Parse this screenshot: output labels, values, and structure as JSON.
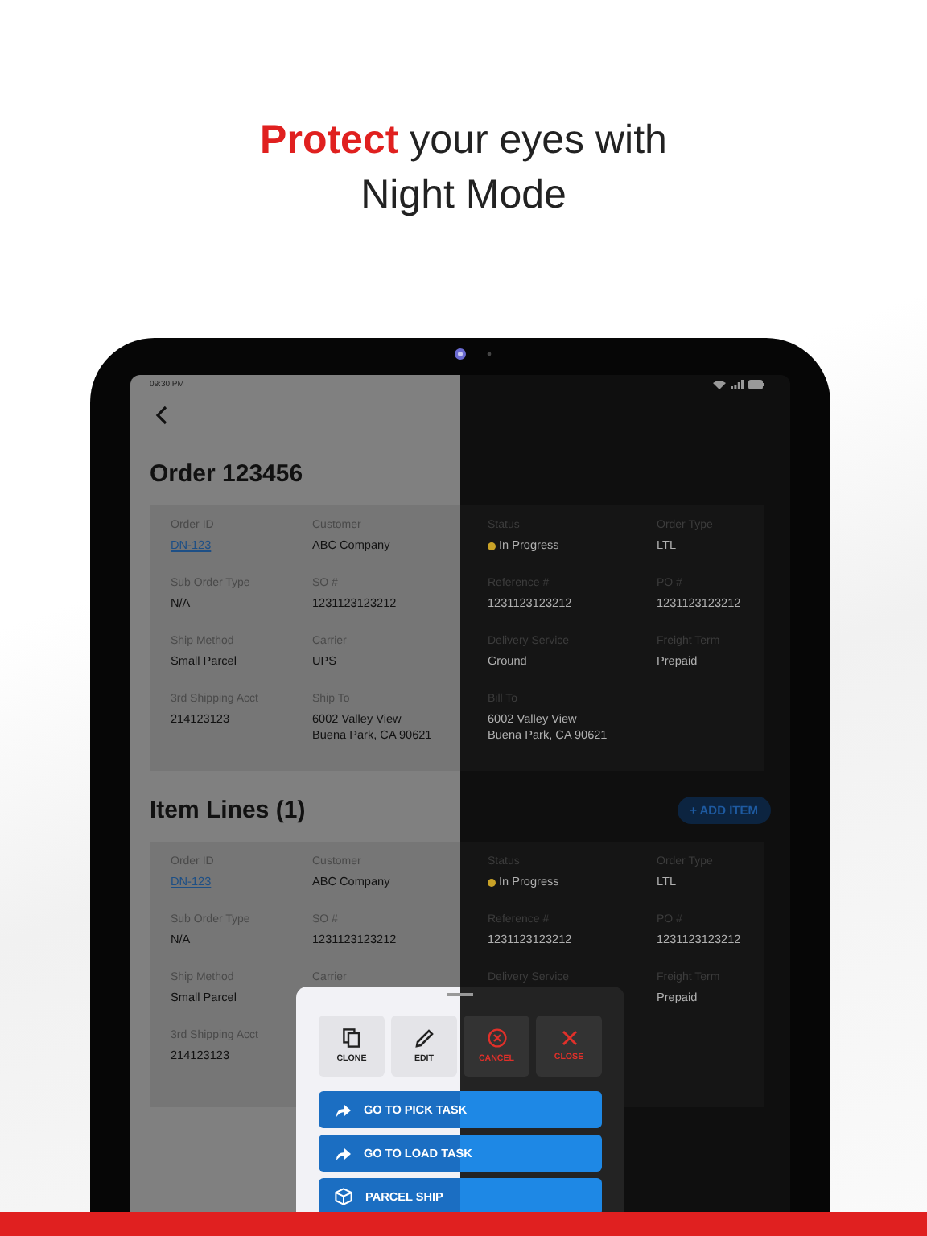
{
  "headline": {
    "line1": "**Protect** your eyes with",
    "line2": "Night Mode"
  },
  "status_bar": {
    "time": "09:30 PM"
  },
  "order": {
    "title": "Order 123456",
    "columns": [
      [
        {
          "label": "Order ID",
          "value": "DN-123",
          "kind": "link"
        },
        {
          "label": "Sub Order Type",
          "value": "N/A",
          "kind": "text"
        },
        {
          "label": "Ship Method",
          "value": "Small Parcel",
          "kind": "text"
        },
        {
          "label": "3rd Shipping Acct",
          "value": "214123123",
          "kind": "text"
        }
      ],
      [
        {
          "label": "Customer",
          "value": "ABC Company",
          "kind": "text"
        },
        {
          "label": "SO #",
          "value": "1231123123212",
          "kind": "text"
        },
        {
          "label": "Carrier",
          "value": "UPS",
          "kind": "text"
        },
        {
          "label": "Ship To",
          "value": "6002 Valley View\nBuena Park, CA 90621",
          "kind": "text"
        }
      ],
      [
        {
          "label": "Status",
          "value": "In Progress",
          "kind": "status",
          "color": "#c9a227"
        },
        {
          "label": "Reference #",
          "value": "1231123123212",
          "kind": "text"
        },
        {
          "label": "Delivery Service",
          "value": "Ground",
          "kind": "text"
        },
        {
          "label": "Bill To",
          "value": "6002 Valley View\nBuena Park, CA 90621",
          "kind": "text"
        }
      ],
      [
        {
          "label": "Order Type",
          "value": "LTL",
          "kind": "text"
        },
        {
          "label": "PO #",
          "value": "1231123123212",
          "kind": "text"
        },
        {
          "label": "Freight Term",
          "value": "Prepaid",
          "kind": "text"
        }
      ]
    ]
  },
  "item_lines": {
    "title": "Item Lines (1)",
    "add_button": "+ ADD ITEM",
    "columns": [
      [
        {
          "label": "Order ID",
          "value": "DN-123",
          "kind": "link"
        },
        {
          "label": "Sub Order Type",
          "value": "N/A",
          "kind": "text"
        },
        {
          "label": "Ship Method",
          "value": "Small Parcel",
          "kind": "text"
        },
        {
          "label": "3rd Shipping Acct",
          "value": "214123123",
          "kind": "text"
        }
      ],
      [
        {
          "label": "Customer",
          "value": "ABC Company",
          "kind": "text"
        },
        {
          "label": "SO #",
          "value": "1231123123212",
          "kind": "text"
        },
        {
          "label": "Carrier"
        }
      ],
      [
        {
          "label": "Status",
          "value": "In Progress",
          "kind": "status",
          "color": "#c9a227"
        },
        {
          "label": "Reference #",
          "value": "1231123123212",
          "kind": "text"
        },
        {
          "label": "Delivery Service"
        }
      ],
      [
        {
          "label": "Order Type",
          "value": "LTL",
          "kind": "text"
        },
        {
          "label": "PO #",
          "value": "1231123123212",
          "kind": "text"
        },
        {
          "label": "Freight Term",
          "value": "Prepaid",
          "kind": "text"
        }
      ]
    ]
  },
  "sheet": {
    "tiles": [
      {
        "label": "CLONE",
        "kind": "clone"
      },
      {
        "label": "EDIT",
        "kind": "edit"
      },
      {
        "label": "CANCEL",
        "kind": "cancel"
      },
      {
        "label": "CLOSE",
        "kind": "close"
      }
    ],
    "actions": [
      {
        "label": "GO TO PICK TASK",
        "kind": "forward"
      },
      {
        "label": "GO TO LOAD TASK",
        "kind": "forward"
      },
      {
        "label": "PARCEL SHIP",
        "kind": "parcel"
      }
    ]
  }
}
